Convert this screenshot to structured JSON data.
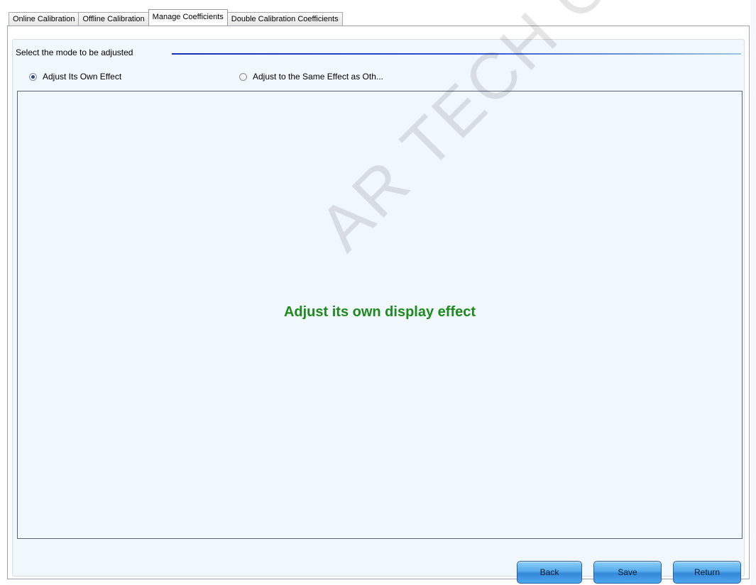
{
  "tabs": [
    {
      "label": "Online Calibration",
      "active": false
    },
    {
      "label": "Offline Calibration",
      "active": false
    },
    {
      "label": "Manage Coefficients",
      "active": true
    },
    {
      "label": "Double Calibration Coefficients",
      "active": false
    }
  ],
  "mode_group": {
    "title": "Select the mode to be adjusted",
    "options": [
      {
        "label": "Adjust Its Own Effect",
        "checked": true
      },
      {
        "label": "Adjust to the Same Effect as Oth...",
        "checked": false
      }
    ]
  },
  "display": {
    "message": "Adjust its own display effect",
    "message_color": "#1e8a1e"
  },
  "watermark": "AR TECH CO.,LTD.",
  "buttons": {
    "back": "Back",
    "save": "Save",
    "return": "Return"
  }
}
